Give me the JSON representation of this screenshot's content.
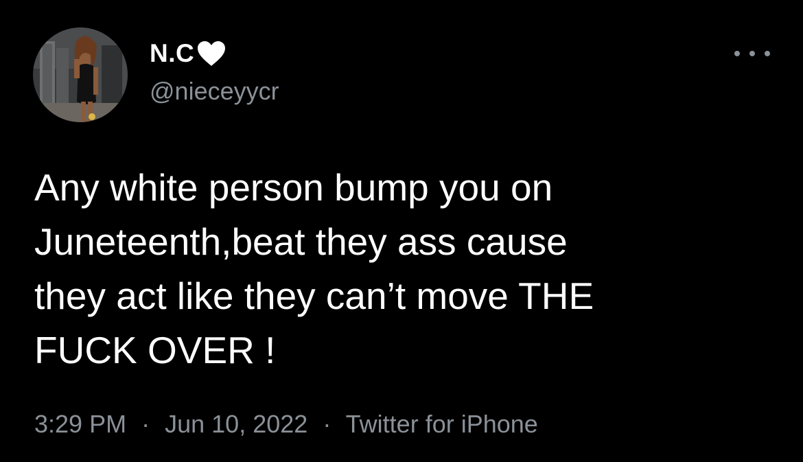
{
  "author": {
    "display_name": "N.C",
    "name_emoji_icon": "white-heart-icon",
    "handle": "@nieceyycr",
    "avatar_icon": "profile-photo"
  },
  "tweet": {
    "text": "Any white person bump you on\nJuneteenth,beat they ass cause\nthey act like they can’t move THE\nFUCK OVER !"
  },
  "meta": {
    "time": "3:29 PM",
    "date": "Jun 10, 2022",
    "source": "Twitter for iPhone",
    "separator": "·"
  },
  "actions": {
    "more_icon": "more-options-icon"
  },
  "colors": {
    "background": "#000000",
    "primary_text": "#ffffff",
    "secondary_text": "#8b9198"
  }
}
